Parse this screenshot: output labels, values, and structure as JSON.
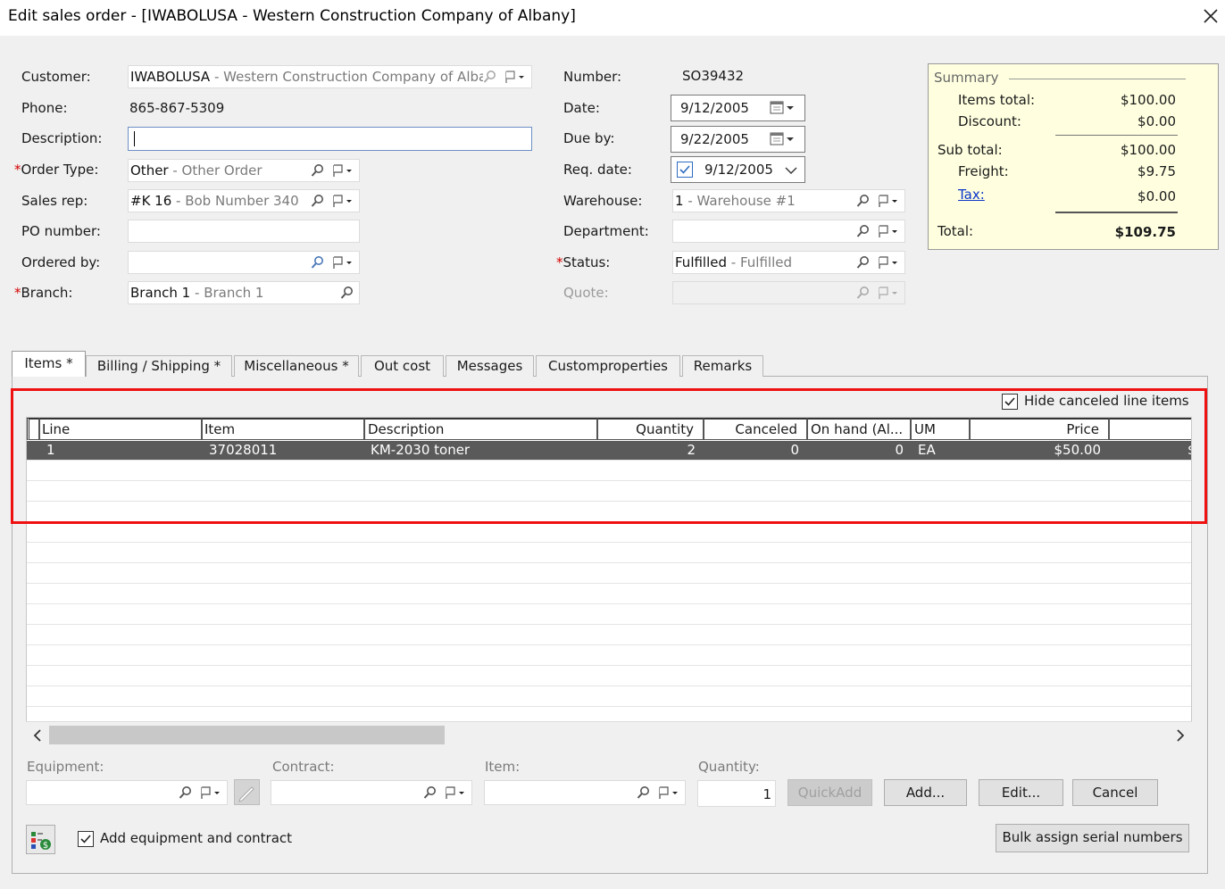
{
  "window": {
    "title": "Edit sales order - [IWABOLUSA - Western Construction Company of Albany]"
  },
  "left_fields": {
    "customer": {
      "label": "Customer:",
      "code": "IWABOLUSA",
      "sep": " - ",
      "desc": "Western Construction Company of Alba"
    },
    "phone": {
      "label": "Phone:",
      "value": "865-867-5309"
    },
    "description": {
      "label": "Description:",
      "value": ""
    },
    "order_type": {
      "label": "Order Type:",
      "required_mark": "*",
      "code": "Other",
      "sep": " - ",
      "desc": "Other Order"
    },
    "sales_rep": {
      "label": "Sales rep:",
      "code": "#K 16",
      "sep": " - ",
      "desc": "Bob Number 340"
    },
    "po_number": {
      "label": "PO number:",
      "value": ""
    },
    "ordered_by": {
      "label": "Ordered by:",
      "value": ""
    },
    "branch": {
      "label": "Branch:",
      "required_mark": "*",
      "code": "Branch 1",
      "sep": " - ",
      "desc": "Branch 1"
    }
  },
  "mid_fields": {
    "number": {
      "label": "Number:",
      "value": "SO39432"
    },
    "date": {
      "label": "Date:",
      "value": "9/12/2005"
    },
    "due_by": {
      "label": "Due by:",
      "value": "9/22/2005"
    },
    "req_date": {
      "label": "Req. date:",
      "value": "9/12/2005",
      "checked": true
    },
    "warehouse": {
      "label": "Warehouse:",
      "code": "1",
      "sep": " - ",
      "desc": "Warehouse #1"
    },
    "department": {
      "label": "Department:",
      "value": ""
    },
    "status": {
      "label": "Status:",
      "required_mark": "*",
      "code": "Fulfilled",
      "sep": " - ",
      "desc": "Fulfilled"
    },
    "quote": {
      "label": "Quote:",
      "value": ""
    }
  },
  "summary": {
    "header": "Summary",
    "items_total_label": "Items total:",
    "items_total": "$100.00",
    "discount_label": "Discount:",
    "discount": "$0.00",
    "sub_total_label": "Sub total:",
    "sub_total": "$100.00",
    "freight_label": "Freight:",
    "freight": "$9.75",
    "tax_label": "Tax:",
    "tax": "$0.00",
    "total_label": "Total:",
    "total": "$109.75"
  },
  "tabs": [
    {
      "label": "Items",
      "marker": "*"
    },
    {
      "label": "Billing / Shipping",
      "marker": "*"
    },
    {
      "label": "Miscellaneous",
      "marker": "*"
    },
    {
      "label": "Out cost",
      "marker": ""
    },
    {
      "label": "Messages",
      "marker": ""
    },
    {
      "label": "Customproperties",
      "marker": ""
    },
    {
      "label": "Remarks",
      "marker": ""
    }
  ],
  "hide_canceled": {
    "label": "Hide canceled line items",
    "checked": true
  },
  "grid": {
    "columns": [
      "Line",
      "Item",
      "Description",
      "Quantity",
      "Canceled",
      "On hand (Al...",
      "UM",
      "Price"
    ],
    "rows": [
      {
        "line": "1",
        "item": "37028011",
        "description": "KM-2030 toner",
        "quantity": "2",
        "canceled": "0",
        "on_hand": "0",
        "um": "EA",
        "price": "$50.00",
        "overflow": "$"
      }
    ]
  },
  "bottom": {
    "equipment_label": "Equipment:",
    "contract_label": "Contract:",
    "item_label": "Item:",
    "quantity_label": "Quantity:",
    "quantity_value": "1",
    "quickadd": "QuickAdd",
    "add": "Add...",
    "edit": "Edit...",
    "cancel": "Cancel",
    "add_equipment_label": "Add equipment and contract",
    "add_equipment_checked": true,
    "bulk_assign": "Bulk assign serial numbers"
  },
  "colors": {
    "highlight": "#ef1111",
    "summary_bg": "#ffffe0",
    "selected_row": "#5a5a5a",
    "link": "#0b35c8",
    "required": "#d40000"
  }
}
